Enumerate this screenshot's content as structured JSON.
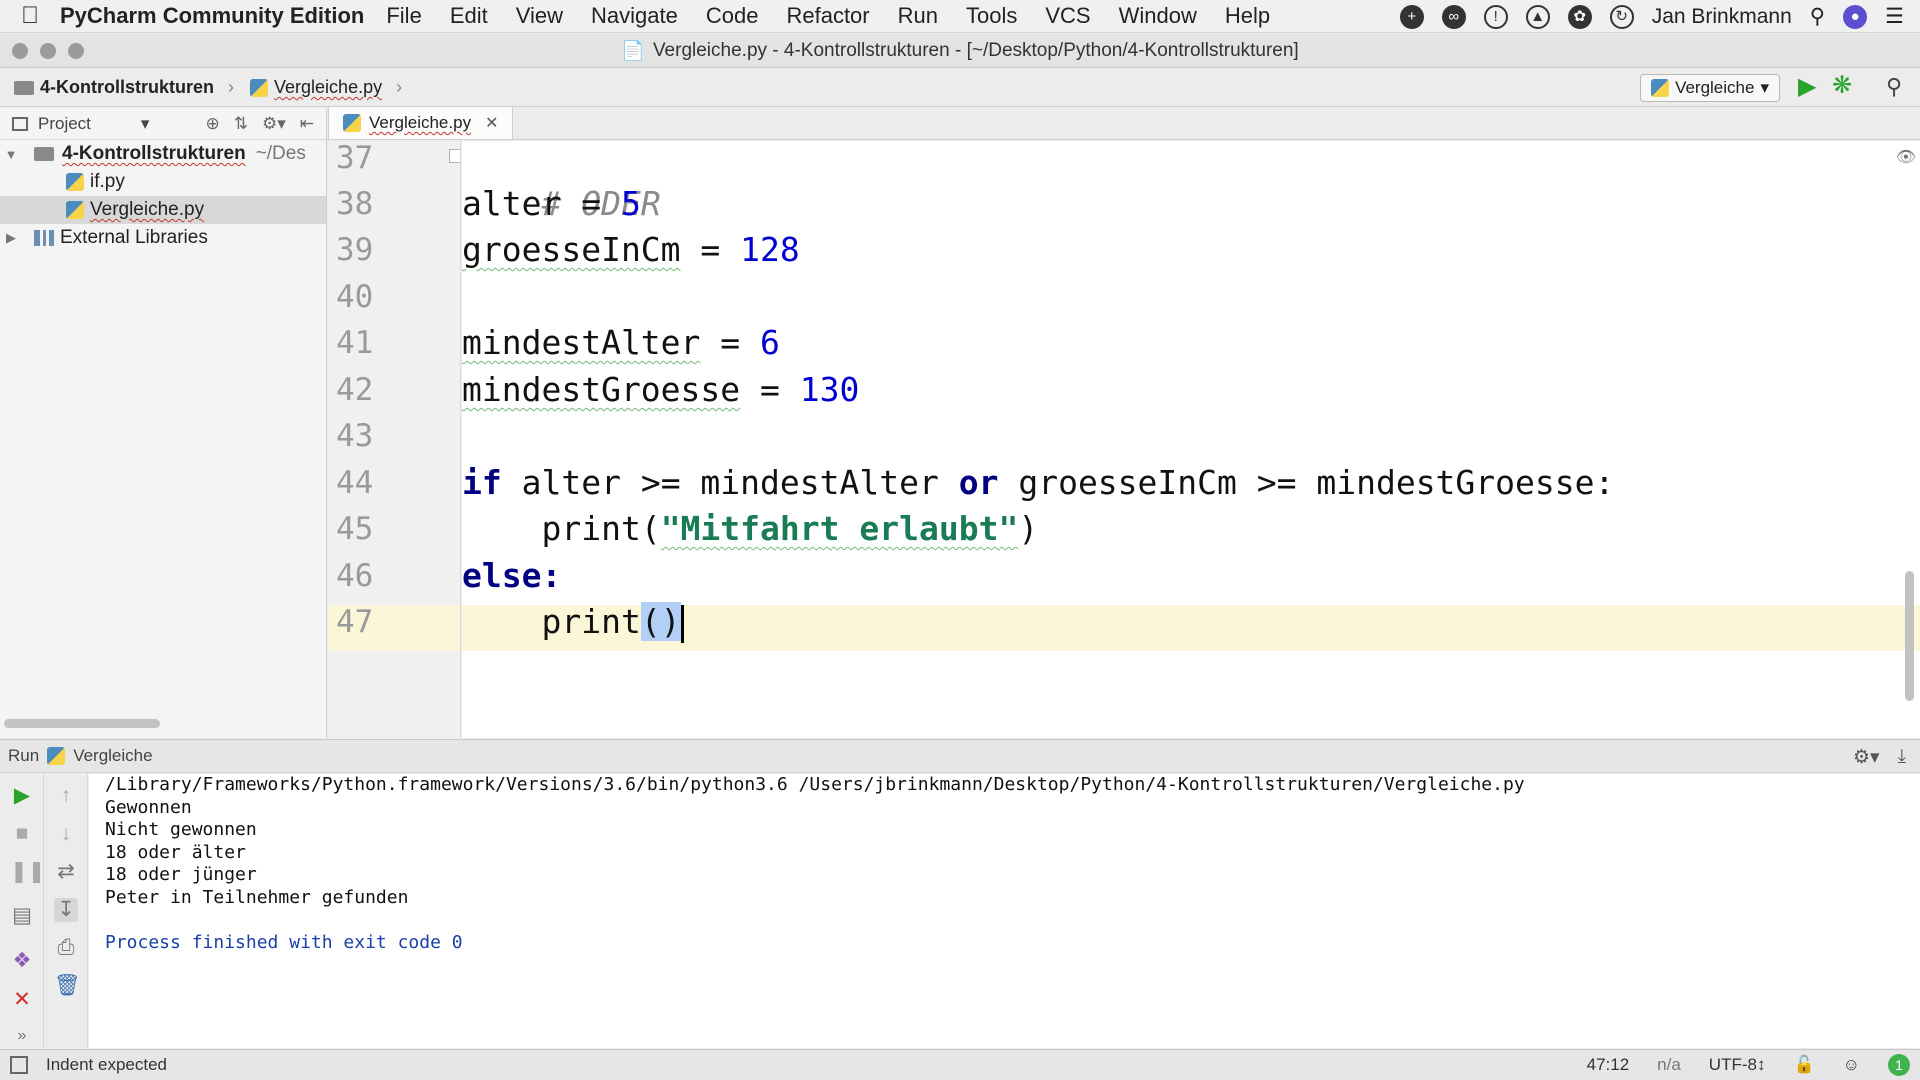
{
  "menubar": {
    "app_name": "PyCharm Community Edition",
    "items": [
      "File",
      "Edit",
      "View",
      "Navigate",
      "Code",
      "Refactor",
      "Run",
      "Tools",
      "VCS",
      "Window",
      "Help"
    ],
    "user": "Jan Brinkmann"
  },
  "window": {
    "title": "Vergleiche.py - 4-Kontrollstrukturen - [~/Desktop/Python/4-Kontrollstrukturen]"
  },
  "breadcrumb": {
    "folder": "4-Kontrollstrukturen",
    "file": "Vergleiche.py"
  },
  "toolbar": {
    "run_config": "Vergleiche"
  },
  "project_panel": {
    "title": "Project",
    "root_name": "4-Kontrollstrukturen",
    "root_path": "~/Des",
    "files": [
      "if.py",
      "Vergleiche.py"
    ],
    "external": "External Libraries"
  },
  "editor": {
    "tab_label": "Vergleiche.py",
    "line_numbers": [
      "37",
      "38",
      "39",
      "40",
      "41",
      "42",
      "43",
      "44",
      "45",
      "46",
      "47"
    ],
    "lines": {
      "l37": "# ODER",
      "l38_var": "alter",
      "l38_op": " = ",
      "l38_val": "5",
      "l39_var": "groesseInCm",
      "l39_op": " = ",
      "l39_val": "128",
      "l41_var": "mindestAlter",
      "l41_op": " = ",
      "l41_val": "6",
      "l42_var": "mindestGroesse",
      "l42_op": " = ",
      "l42_val": "130",
      "l44_if": "if",
      "l44_a": " alter >= mindestAlter ",
      "l44_or": "or",
      "l44_b": " groesseInCm >= mindestGroesse:",
      "l45_fn": "    print(",
      "l45_str": "\"Mitfahrt erlaubt\"",
      "l45_end": ")",
      "l46_else": "else",
      "l46_colon": ":",
      "l47_fn": "    print",
      "l47_paren": "()"
    }
  },
  "run_panel": {
    "label": "Run",
    "config": "Vergleiche",
    "console_lines": [
      "/Library/Frameworks/Python.framework/Versions/3.6/bin/python3.6 /Users/jbrinkmann/Desktop/Python/4-Kontrollstrukturen/Vergleiche.py",
      "Gewonnen",
      "Nicht gewonnen",
      "18 oder älter",
      "18 oder jünger",
      "Peter in Teilnehmer gefunden",
      "",
      "Process finished with exit code 0"
    ]
  },
  "statusbar": {
    "message": "Indent expected",
    "position": "47:12",
    "na": "n/a",
    "encoding": "UTF-8↕",
    "notifications": "1"
  },
  "colors": {
    "keyword": "#000080",
    "number": "#0000d0",
    "string": "#1a7c55",
    "current_line": "#fbf6d8",
    "run_green": "#29a329"
  }
}
